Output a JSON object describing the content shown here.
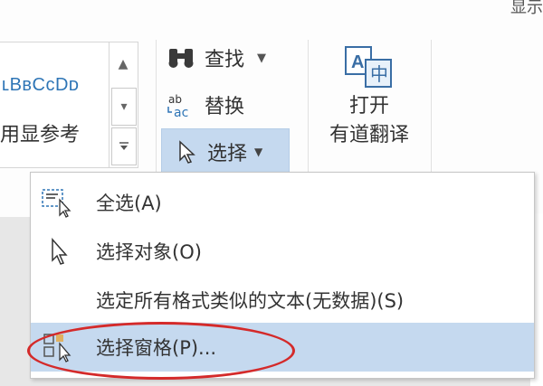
{
  "ribbon": {
    "top_partial": "显示",
    "styles": {
      "sample_text": "AaBbCcDd",
      "visible_sample": "ʟBʙCᴄDᴅ",
      "style_name": "明显参考",
      "visible_name": "用显参考"
    },
    "editing": {
      "find_label": "查找",
      "replace_label": "替换",
      "select_label": "选择"
    },
    "translate": {
      "line1": "打开",
      "line2": "有道翻译"
    }
  },
  "menu": {
    "items": [
      {
        "label": "全选(A)",
        "icon": "select-all-icon"
      },
      {
        "label": "选择对象(O)",
        "icon": "select-objects-icon"
      },
      {
        "label": "选定所有格式类似的文本(无数据)(S)",
        "icon": ""
      },
      {
        "label": "选择窗格(P)...",
        "icon": "selection-pane-icon"
      }
    ]
  },
  "colors": {
    "highlight": "#c5d9ef",
    "annotation_circle": "#d42a2a",
    "style_sample": "#2e75b6"
  }
}
